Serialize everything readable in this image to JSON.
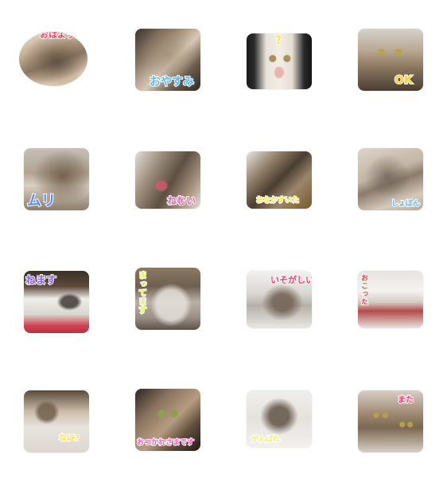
{
  "stickers": [
    {
      "label": "おはよう",
      "color": "#ff3b5c"
    },
    {
      "label": "おやすみ",
      "color": "#5db8ff"
    },
    {
      "label": "?",
      "color": "#ffe14a"
    },
    {
      "label": "OK",
      "color": "#ffd02e"
    },
    {
      "label": "ムリ",
      "color": "#5a8cff"
    },
    {
      "label": "ねむい",
      "color": "#ff5aa8"
    },
    {
      "label": "おなかすいた",
      "color": "#ffe44a"
    },
    {
      "label": "しょぼん",
      "color": "#5fb4ff"
    },
    {
      "label": "ねます",
      "color": "#8a5cff"
    },
    {
      "label": "まってます",
      "color": "#e8f05a"
    },
    {
      "label": "いそがしい",
      "color": "#ff3d6a"
    },
    {
      "label": "おこった",
      "color": "#ff3b3b"
    },
    {
      "label": "なに?",
      "color": "#ffe04a"
    },
    {
      "label": "おつかれさまです",
      "color": "#ff5ac0"
    },
    {
      "label": "がんばれ",
      "color": "#e8f860"
    },
    {
      "label": "また",
      "color": "#ff3b6a"
    }
  ]
}
